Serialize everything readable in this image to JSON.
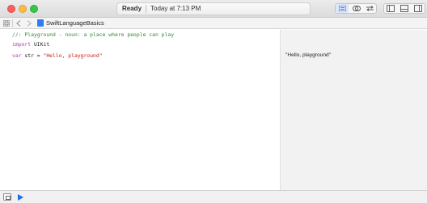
{
  "titlebar": {
    "status": "Ready",
    "time": "Today at 7:13 PM"
  },
  "toolbar": {
    "icons": [
      "standard-editor-icon",
      "assistant-editor-icon",
      "version-editor-icon",
      "navigator-toggle-icon",
      "debug-area-toggle-icon",
      "utilities-toggle-icon"
    ]
  },
  "jumpbar": {
    "filename": "SwiftLanguageBasics"
  },
  "code": {
    "line1": "//: Playground - noun: a place where people can play",
    "line2_keyword": "import",
    "line2_module": " UIKit",
    "line3_keyword": "var",
    "line3_ident": " str = ",
    "line3_string": "\"Hello, playground\""
  },
  "results": {
    "value": "\"Hello, playground\""
  },
  "colors": {
    "comment": "#2f8a2f",
    "keyword": "#ad3da4",
    "string": "#c41a16",
    "accent": "#1c6fe6"
  }
}
